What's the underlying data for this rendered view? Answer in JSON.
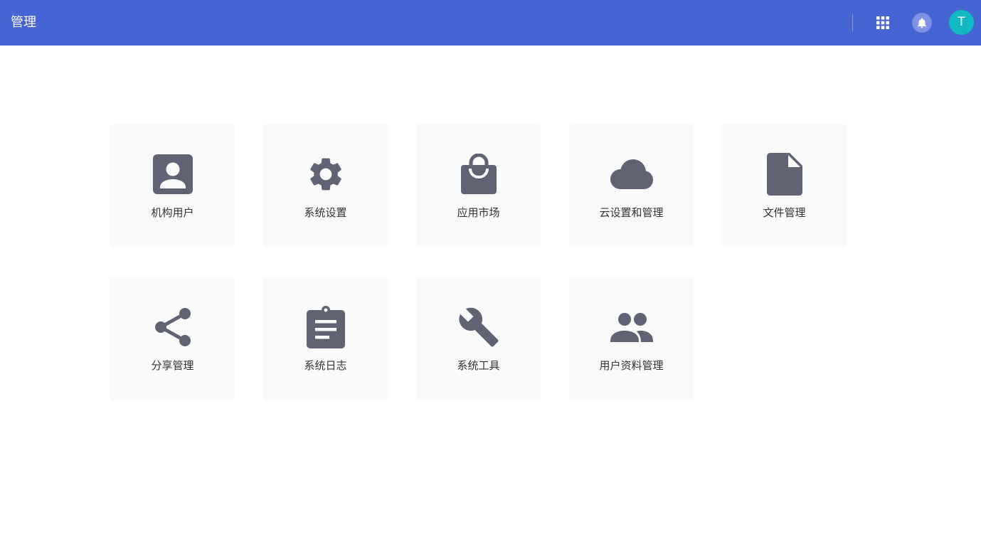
{
  "header": {
    "title": "管理",
    "avatar_initial": "T",
    "colors": {
      "bar": "#4764d4",
      "avatar": "#10b9c0"
    }
  },
  "tiles": [
    {
      "label": "机构用户",
      "icon": "contact-card-icon"
    },
    {
      "label": "系统设置",
      "icon": "gear-icon"
    },
    {
      "label": "应用市场",
      "icon": "shopping-bag-icon"
    },
    {
      "label": "云设置和管理",
      "icon": "cloud-icon"
    },
    {
      "label": "文件管理",
      "icon": "file-icon"
    },
    {
      "label": "分享管理",
      "icon": "share-icon"
    },
    {
      "label": "系统日志",
      "icon": "clipboard-icon"
    },
    {
      "label": "系统工具",
      "icon": "wrench-icon"
    },
    {
      "label": "用户资料管理",
      "icon": "people-icon"
    }
  ],
  "icon_color": "#5f6373"
}
